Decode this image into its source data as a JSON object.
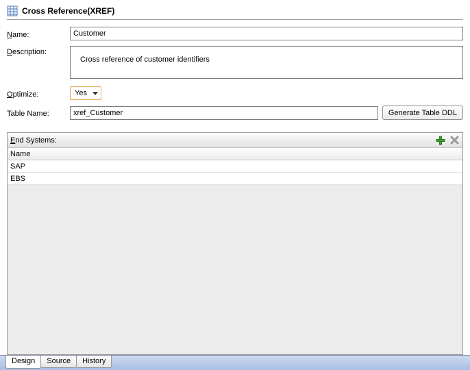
{
  "header": {
    "title": "Cross Reference(XREF)"
  },
  "form": {
    "name_label": "Name:",
    "name_value": "Customer",
    "description_label": "Description:",
    "description_value": "Cross reference of customer identifiers",
    "optimize_label": "Optimize:",
    "optimize_value": "Yes",
    "tablename_label": "Table Name:",
    "tablename_value": "xref_Customer",
    "generate_btn": "Generate Table DDL"
  },
  "panel": {
    "title": "End Systems:",
    "column_name": "Name",
    "rows": [
      "SAP",
      "EBS"
    ]
  },
  "tabs": {
    "design": "Design",
    "source": "Source",
    "history": "History"
  },
  "icons": {
    "add": "add-icon",
    "delete": "delete-icon",
    "dropdown": "chevron-down-icon",
    "header": "grid-icon"
  }
}
